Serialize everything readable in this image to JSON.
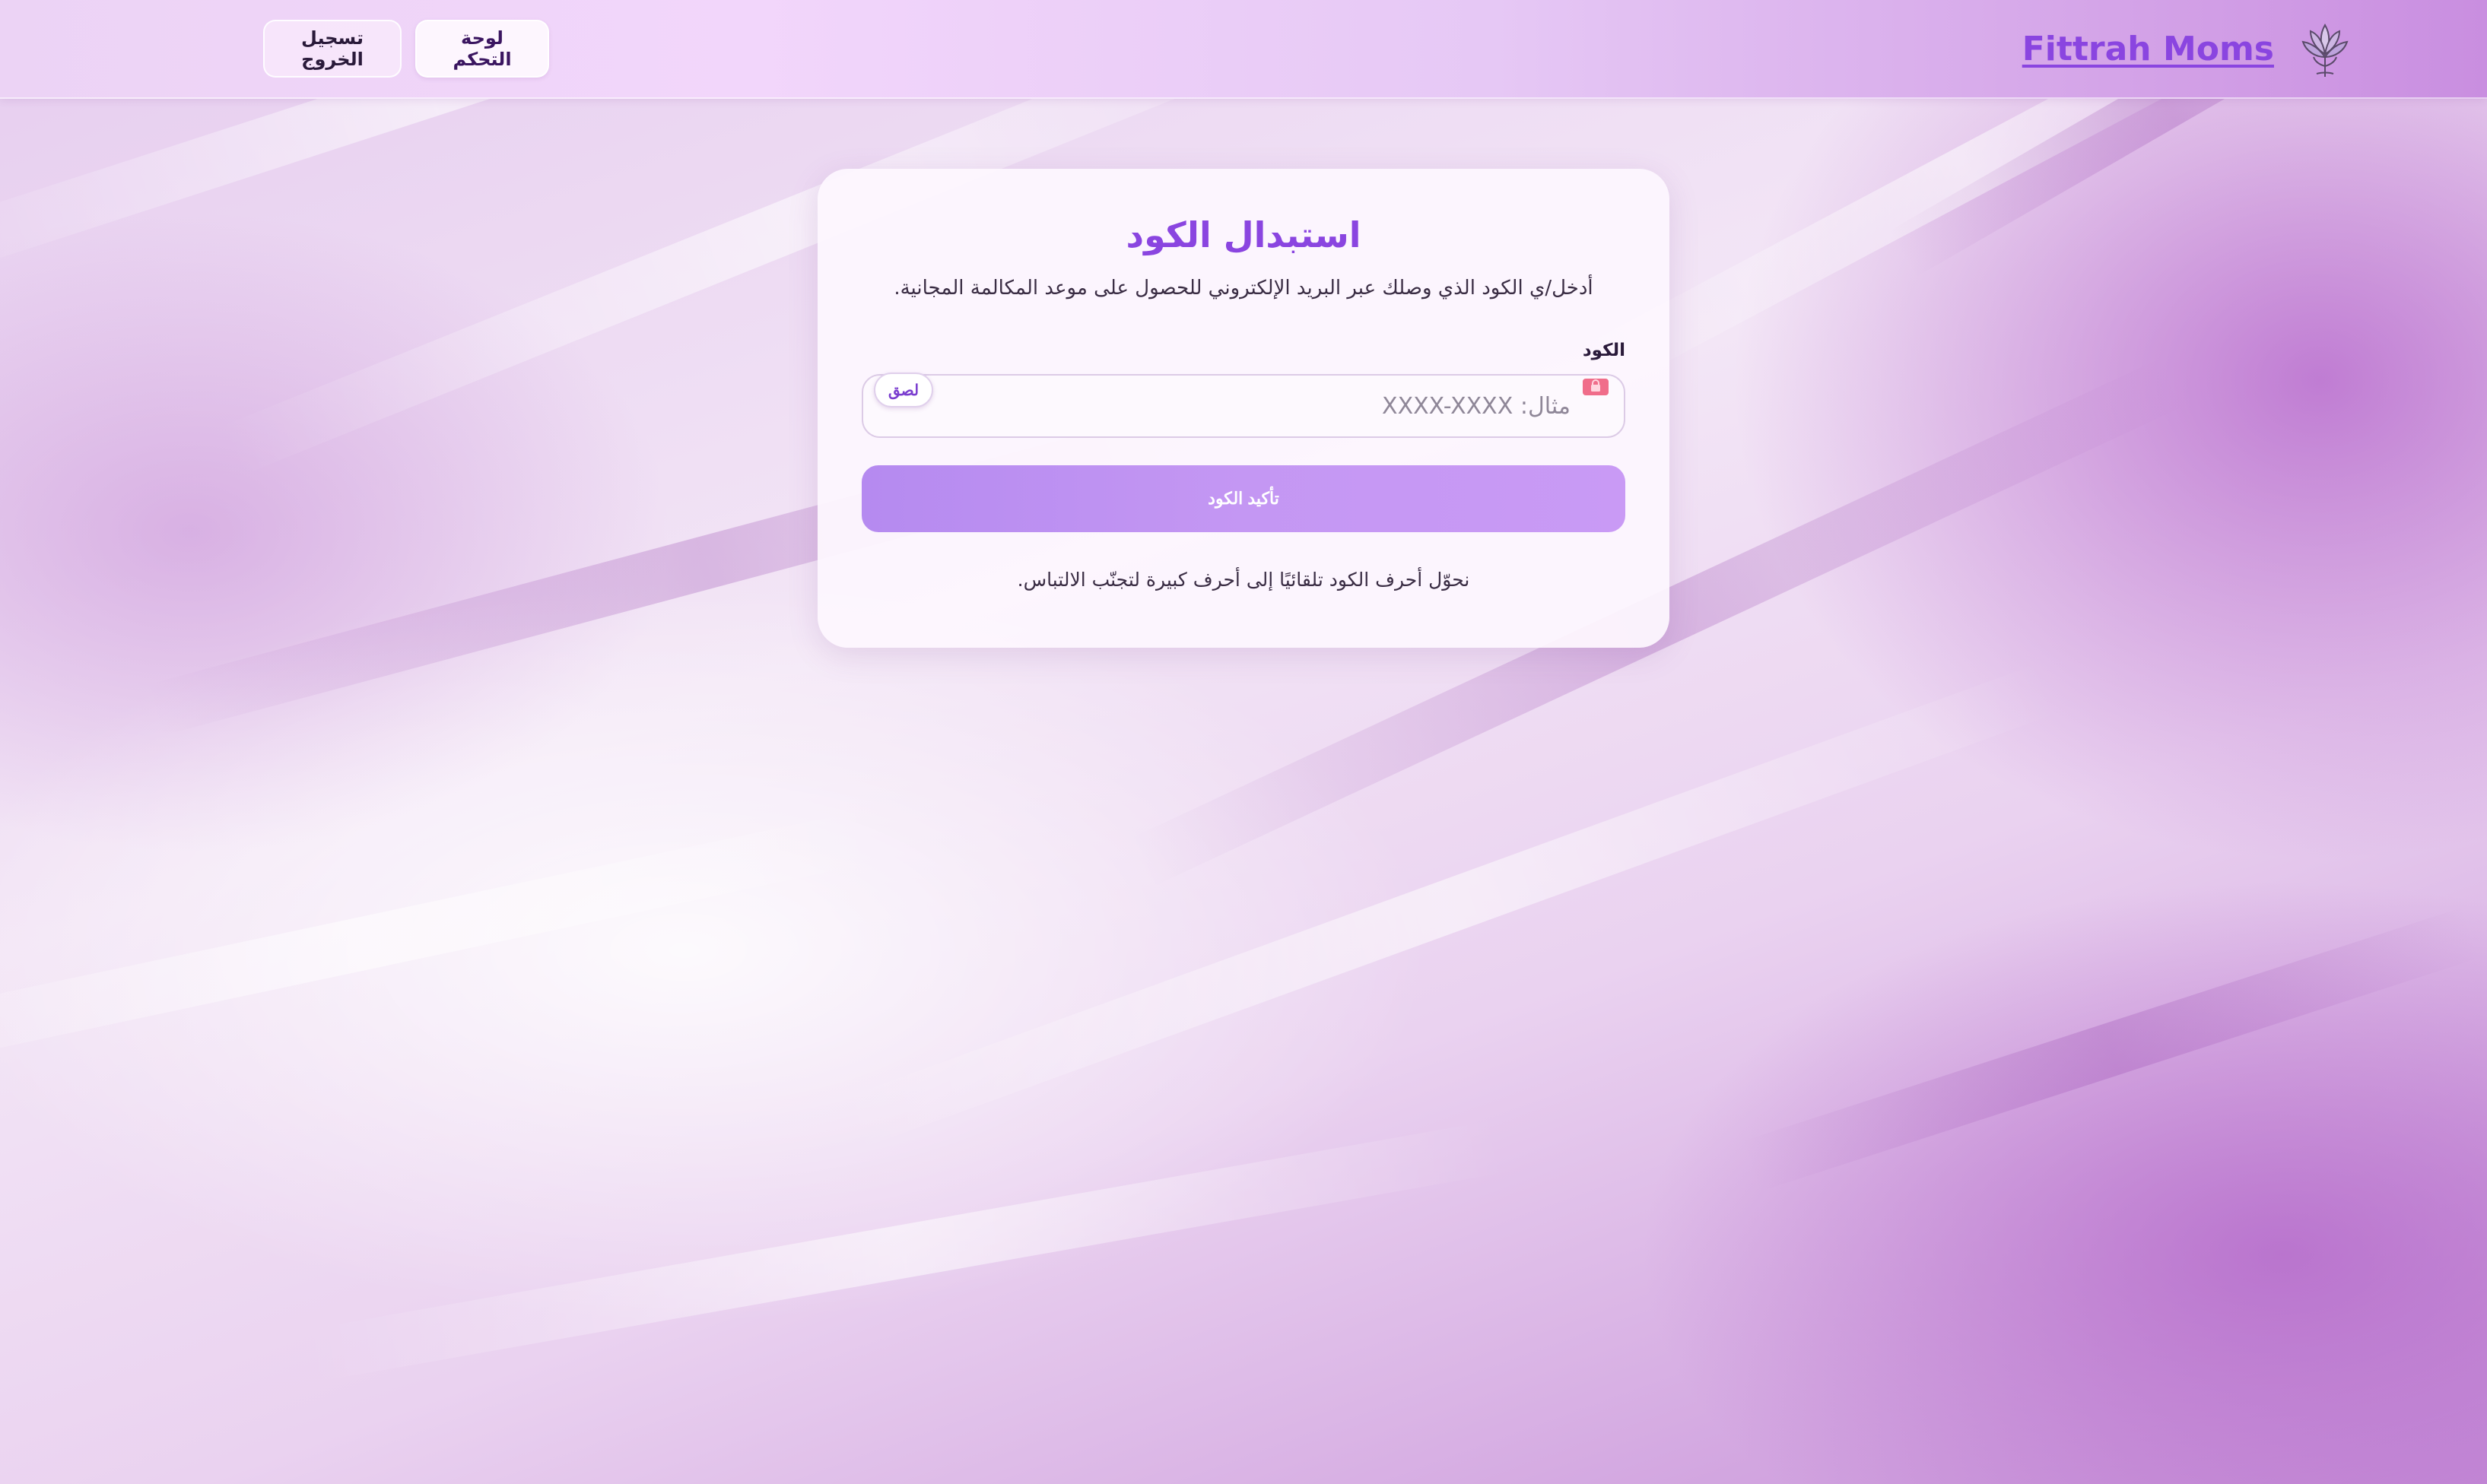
{
  "header": {
    "brand_name": "Fittrah Moms",
    "nav": {
      "dashboard_label": "لوحة التحكم",
      "logout_label": "تسجيل الخروج"
    }
  },
  "card": {
    "title": "استبدال الكود",
    "subtitle": "أدخل/ي الكود الذي وصلك عبر البريد الإلكتروني للحصول على موعد المكالمة المجانية.",
    "code_field": {
      "label": "الكود",
      "value": "",
      "placeholder": "مثال: XXXX-XXXX",
      "paste_label": "لصق"
    },
    "submit_label": "تأكيد الكود",
    "note": "نحوّل أحرف الكود تلقائيًا إلى أحرف كبيرة لتجنّب الالتباس."
  },
  "colors": {
    "accent": "#8a45e0",
    "button": "#c497f3",
    "background": "#efe0f4"
  },
  "icons": {
    "logo": "lotus-flower-icon",
    "field": "lock-icon"
  }
}
